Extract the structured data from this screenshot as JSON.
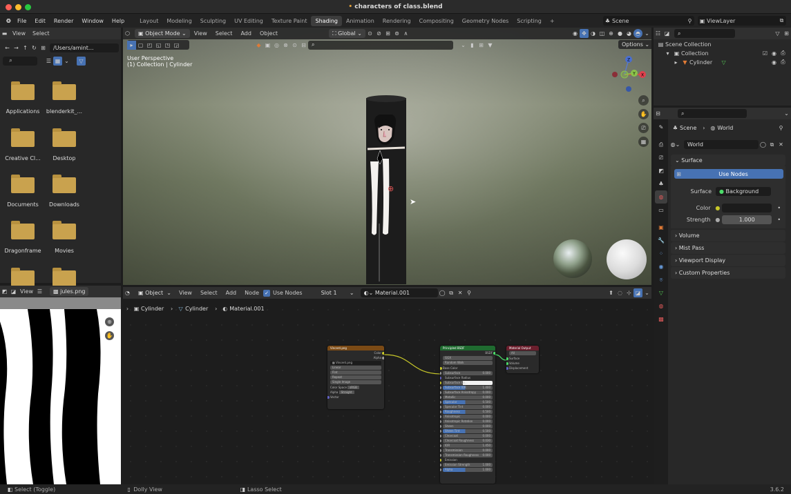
{
  "window": {
    "title": "characters of class.blend",
    "modified_marker": "•"
  },
  "top_menu": [
    "File",
    "Edit",
    "Render",
    "Window",
    "Help"
  ],
  "workspace_tabs": [
    {
      "label": "Layout",
      "active": false
    },
    {
      "label": "Modeling",
      "active": false
    },
    {
      "label": "Sculpting",
      "active": false
    },
    {
      "label": "UV Editing",
      "active": false
    },
    {
      "label": "Texture Paint",
      "active": false
    },
    {
      "label": "Shading",
      "active": true
    },
    {
      "label": "Animation",
      "active": false
    },
    {
      "label": "Rendering",
      "active": false
    },
    {
      "label": "Compositing",
      "active": false
    },
    {
      "label": "Geometry Nodes",
      "active": false
    },
    {
      "label": "Scripting",
      "active": false
    }
  ],
  "add_tab": "+",
  "scene": {
    "label": "Scene"
  },
  "view_layer": {
    "label": "ViewLayer"
  },
  "file_browser": {
    "menu": [
      "View",
      "Select"
    ],
    "path": "/Users/amint...",
    "items": [
      "Applications",
      "blenderkit_...",
      "Creative Cl...",
      "Desktop",
      "Documents",
      "Downloads",
      "Dragonframe",
      "Movies",
      "",
      ""
    ]
  },
  "viewport": {
    "mode": "Object Mode",
    "menu": [
      "View",
      "Select",
      "Add",
      "Object"
    ],
    "transform": "Global",
    "options": "Options",
    "overlay_line1": "User Perspective",
    "overlay_line2": "(1) Collection | Cylinder",
    "gizmo": {
      "z": "Z",
      "y": "Y",
      "x": "X"
    }
  },
  "image_editor": {
    "view": "View",
    "image": "jules.png"
  },
  "node_editor": {
    "type": "Object",
    "menu": [
      "View",
      "Select",
      "Add",
      "Node"
    ],
    "use_nodes": "Use Nodes",
    "slot": "Slot 1",
    "material": "Material.001",
    "breadcrumb": [
      "Cylinder",
      "Cylinder",
      "Material.001"
    ],
    "image_node": {
      "title": "Vincent.png",
      "out1": "Color",
      "out2": "Alpha",
      "image": "Vincent.png",
      "fields": [
        "Linear",
        "Flat",
        "Repeat",
        "Single Image"
      ],
      "color_space_label": "Color Space",
      "color_space": "sRGB",
      "alpha_label": "Alpha",
      "alpha": "Straight",
      "vector": "Vector"
    },
    "bsdf_node": {
      "title": "Principled BSDF",
      "out": "BSDF",
      "dist": "GGX",
      "sss": "Random Walk",
      "base_color": "Base Color",
      "rows": [
        {
          "name": "Subsurface",
          "value": "0.000"
        },
        {
          "name": "Subsurface Radius",
          "value": ""
        },
        {
          "name": "Subsurface Co...",
          "value": ""
        },
        {
          "name": "Subsurface IOR",
          "value": "1.400"
        },
        {
          "name": "Subsurface Anisotropy",
          "value": "0.000"
        },
        {
          "name": "Metallic",
          "value": "0.000"
        },
        {
          "name": "Specular",
          "value": "0.500"
        },
        {
          "name": "Specular Tint",
          "value": "0.000"
        },
        {
          "name": "Roughness",
          "value": "0.500"
        },
        {
          "name": "Anisotropic",
          "value": "0.000"
        },
        {
          "name": "Anisotropic Rotation",
          "value": "0.000"
        },
        {
          "name": "Sheen",
          "value": "0.000"
        },
        {
          "name": "Sheen Tint",
          "value": "0.500"
        },
        {
          "name": "Clearcoat",
          "value": "0.000"
        },
        {
          "name": "Clearcoat Roughness",
          "value": "0.030"
        },
        {
          "name": "IOR",
          "value": "1.450"
        },
        {
          "name": "Transmission",
          "value": "0.000"
        },
        {
          "name": "Transmission Roughness",
          "value": "0.000"
        },
        {
          "name": "Emission",
          "value": ""
        },
        {
          "name": "Emission Strength",
          "value": "1.000"
        },
        {
          "name": "Alpha",
          "value": "1.000"
        }
      ]
    },
    "output_node": {
      "title": "Material Output",
      "target": "All",
      "inputs": [
        "Surface",
        "Volume",
        "Displacement"
      ]
    }
  },
  "outliner": {
    "root": "Scene Collection",
    "collection": "Collection",
    "object": "Cylinder"
  },
  "properties": {
    "breadcrumb_scene": "Scene",
    "breadcrumb_world": "World",
    "world_name": "World",
    "surface_panel": "Surface",
    "use_nodes": "Use Nodes",
    "surface_label": "Surface",
    "surface_value": "Background",
    "color_label": "Color",
    "strength_label": "Strength",
    "strength_value": "1.000",
    "panels": [
      "Volume",
      "Mist Pass",
      "Viewport Display",
      "Custom Properties"
    ]
  },
  "status_bar": {
    "left": "Select (Toggle)",
    "mid": "Dolly View",
    "right": "Lasso Select",
    "version": "3.6.2"
  },
  "colors": {
    "accent": "#4772b3",
    "active_tab": "#3d3d3d",
    "folder": "#c9a24e",
    "image_node_header": "#7b4a15",
    "bsdf_node_header": "#1f6b30",
    "output_node_header": "#6b1f2d"
  }
}
